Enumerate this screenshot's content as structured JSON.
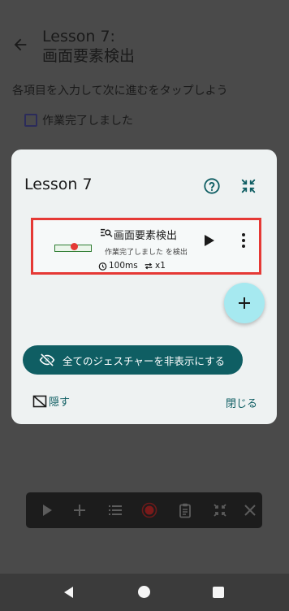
{
  "screen": {
    "title_line1": "Lesson 7:",
    "title_line2": "画面要素検出",
    "instruction": "各項目を入力して次に進むをタップしよう",
    "checkbox_label": "作業完了しました"
  },
  "dialog": {
    "title": "Lesson 7",
    "item": {
      "title": "画面要素検出",
      "subtitle": "作業完了しました を検出",
      "delay": "100ms",
      "repeat": "x1"
    },
    "hide_all_label": "全てのジェスチャーを非表示にする",
    "hide_label": "隠す",
    "close_label": "閉じる"
  },
  "icons": [
    "back-arrow-icon",
    "help-icon",
    "collapse-icon",
    "image-search-icon",
    "play-icon",
    "more-vert-icon",
    "add-icon",
    "visibility-off-icon",
    "hide-icon",
    "timer-icon",
    "repeat-icon",
    "stop-record-icon",
    "list-icon",
    "clipboard-icon",
    "close-icon"
  ],
  "colors": {
    "accent": "#0f5e63",
    "fab": "#a6e9f0",
    "highlight": "#e53935",
    "dialog_bg": "#eef2f2"
  }
}
